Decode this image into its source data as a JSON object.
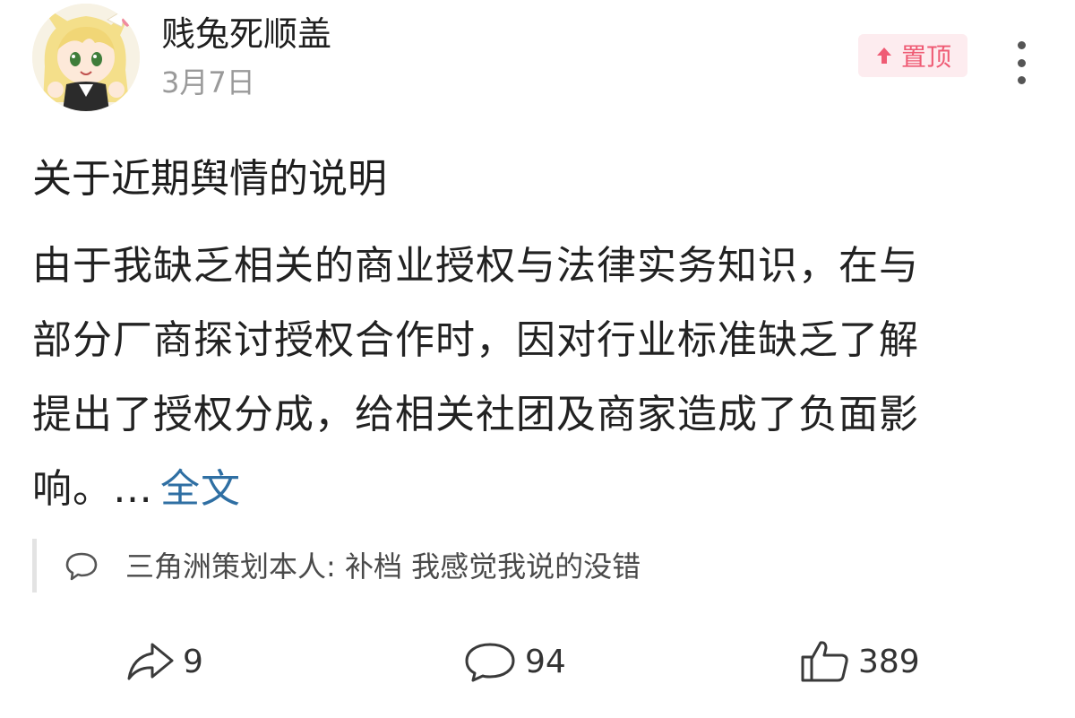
{
  "author": {
    "name": "贱兔死顺盖",
    "date": "3月7日",
    "avatar": "avatar-image"
  },
  "badge": {
    "label": "置顶",
    "icon": "arrow-up-icon",
    "color": "#ef5b74",
    "background": "#fdecef"
  },
  "more_icon": "more-vertical-icon",
  "post": {
    "title": "关于近期舆情的说明",
    "lines": [
      "由于我缺乏相关的商业授权与法律实务知识，在与",
      "部分厂商探讨授权合作时，因对行业标准缺乏了解",
      "提出了授权分成，给相关社团及商家造成了负面影",
      "响。…"
    ],
    "full_text_link": "全文",
    "link_color": "#2f6fa3"
  },
  "quoted_comment": {
    "icon": "comment-bubble-icon",
    "text": "三角洲策划本人: 补档 我感觉我说的没错"
  },
  "actions": {
    "share": {
      "icon": "share-arrow-icon",
      "count": "9"
    },
    "comment": {
      "icon": "comment-icon",
      "count": "94"
    },
    "like": {
      "icon": "thumbs-up-icon",
      "count": "389"
    }
  }
}
